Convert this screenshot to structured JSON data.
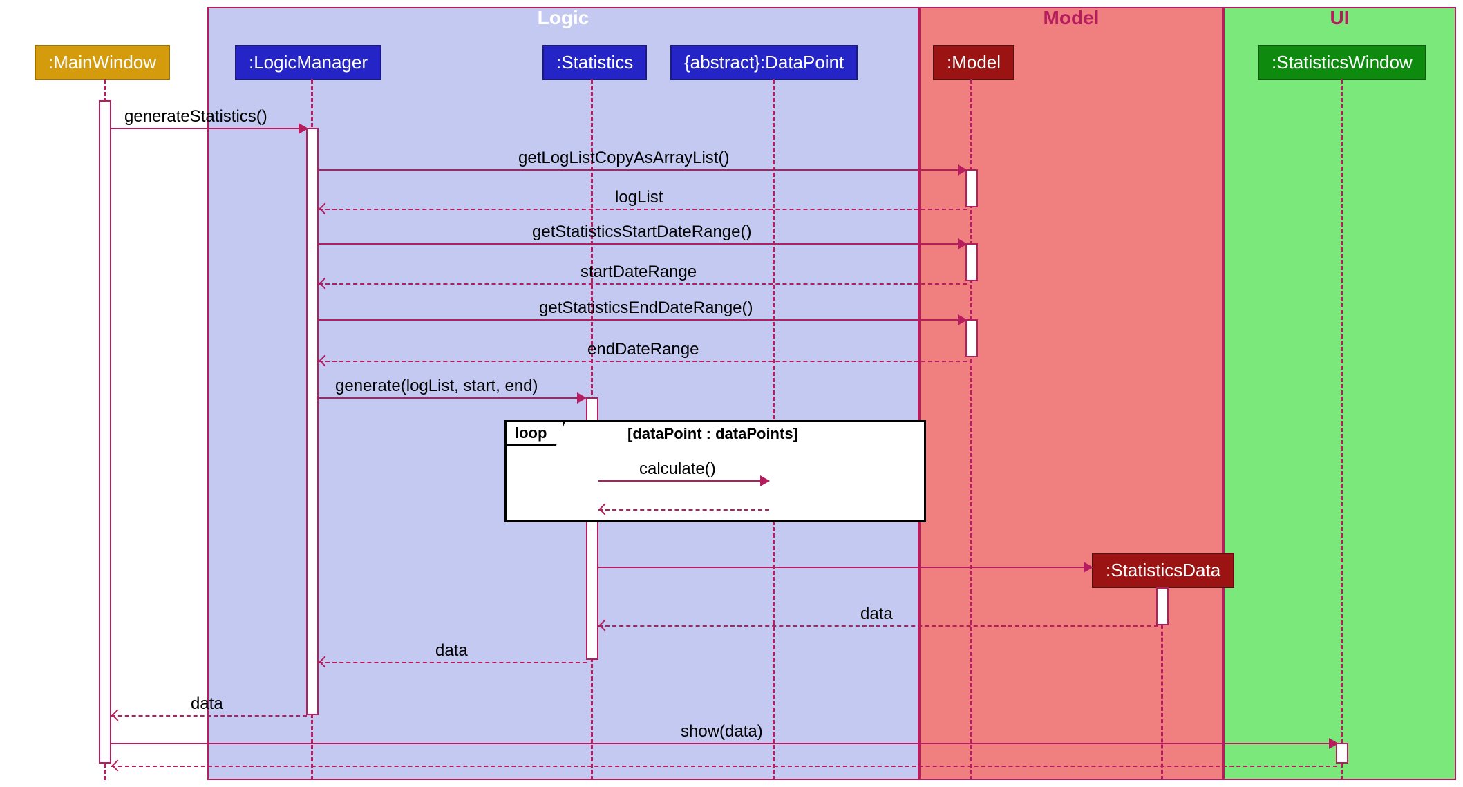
{
  "regions": {
    "logic": {
      "title": "Logic"
    },
    "model": {
      "title": "Model"
    },
    "ui": {
      "title": "UI"
    }
  },
  "participants": {
    "mainWindow": ":MainWindow",
    "logicManager": ":LogicManager",
    "statistics": ":Statistics",
    "dataPoint": "{abstract}:DataPoint",
    "model": ":Model",
    "statisticsData": ":StatisticsData",
    "statisticsWindow": ":StatisticsWindow"
  },
  "messages": {
    "generateStatistics": "generateStatistics()",
    "getLogListCopy": "getLogListCopyAsArrayList()",
    "logList": "logList",
    "getStartDate": "getStatisticsStartDateRange()",
    "startDateRange": "startDateRange",
    "getEndDate": "getStatisticsEndDateRange()",
    "endDateRange": "endDateRange",
    "generate": "generate(logList, start, end)",
    "calculate": "calculate()",
    "dataReturn1": "data",
    "dataReturn2": "data",
    "dataReturn3": "data",
    "show": "show(data)"
  },
  "fragment": {
    "loop": "loop",
    "guard": "[dataPoint : dataPoints]"
  }
}
